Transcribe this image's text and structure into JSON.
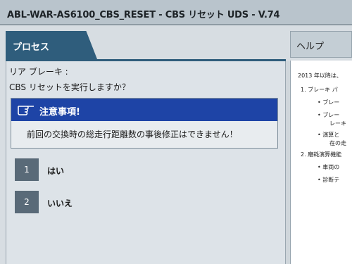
{
  "window": {
    "title": "ABL-WAR-AS6100_CBS_RESET - CBS リセット UDS - V.74"
  },
  "tabs": {
    "process": "プロセス",
    "help": "ヘルプ"
  },
  "main": {
    "heading": "リア ブレーキ :",
    "question": "CBS リセットを実行しますか？",
    "notice": {
      "icon": "pointing-hand-icon",
      "title": "注意事項!",
      "text": "前回の交換時の総走行距離数の事後修正はできません！"
    },
    "options": [
      {
        "number": "1",
        "label": "はい"
      },
      {
        "number": "2",
        "label": "いいえ"
      }
    ]
  },
  "help": {
    "lines": [
      "2013 年以降は、",
      "1.   ブレーキ パ",
      "•   ブレー",
      "•   ブレー",
      "レーキ",
      "•   演算と",
      "在の走",
      "2.   磨耗演算機能",
      "•   車両の",
      "•   診断テ"
    ]
  },
  "colors": {
    "accent": "#2f5d7c",
    "notice_header": "#1e44a6",
    "option_button": "#596a78"
  }
}
